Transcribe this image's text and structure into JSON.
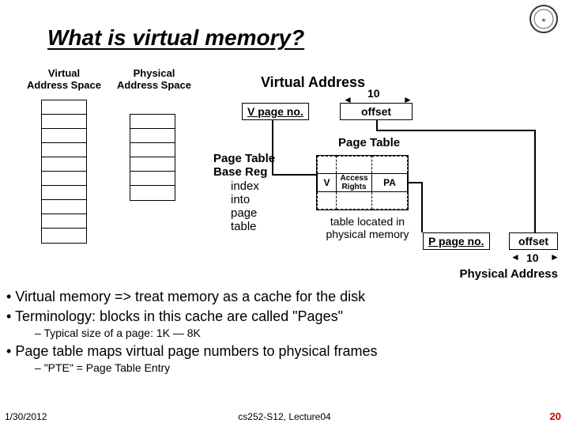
{
  "title": "What is virtual memory?",
  "labels": {
    "vas": "Virtual\nAddress Space",
    "pas": "Physical\nAddress Space",
    "va_title": "Virtual Address",
    "vpage": "V page no.",
    "offset": "offset",
    "ten": "10",
    "ptbr_line1": "Page Table",
    "ptbr_line2": "Base Reg",
    "index": "index\ninto\npage\ntable",
    "pt_title": "Page Table",
    "pt_v": "V",
    "pt_access": "Access\nRights",
    "pt_pa": "PA",
    "pt_note": "table located in physical memory",
    "ppage": "P page no.",
    "pa_label": "Physical Address"
  },
  "bullets": {
    "b1": "Virtual memory => treat memory as a cache for the disk",
    "b2": "Terminology: blocks in this cache are called \"Pages\"",
    "sub1": "Typical size of a page: 1K — 8K",
    "b3": "Page table maps virtual page numbers to physical frames",
    "sub2": "\"PTE\" = Page Table Entry"
  },
  "footer": {
    "date": "1/30/2012",
    "mid": "cs252-S12, Lecture04",
    "num": "20"
  }
}
